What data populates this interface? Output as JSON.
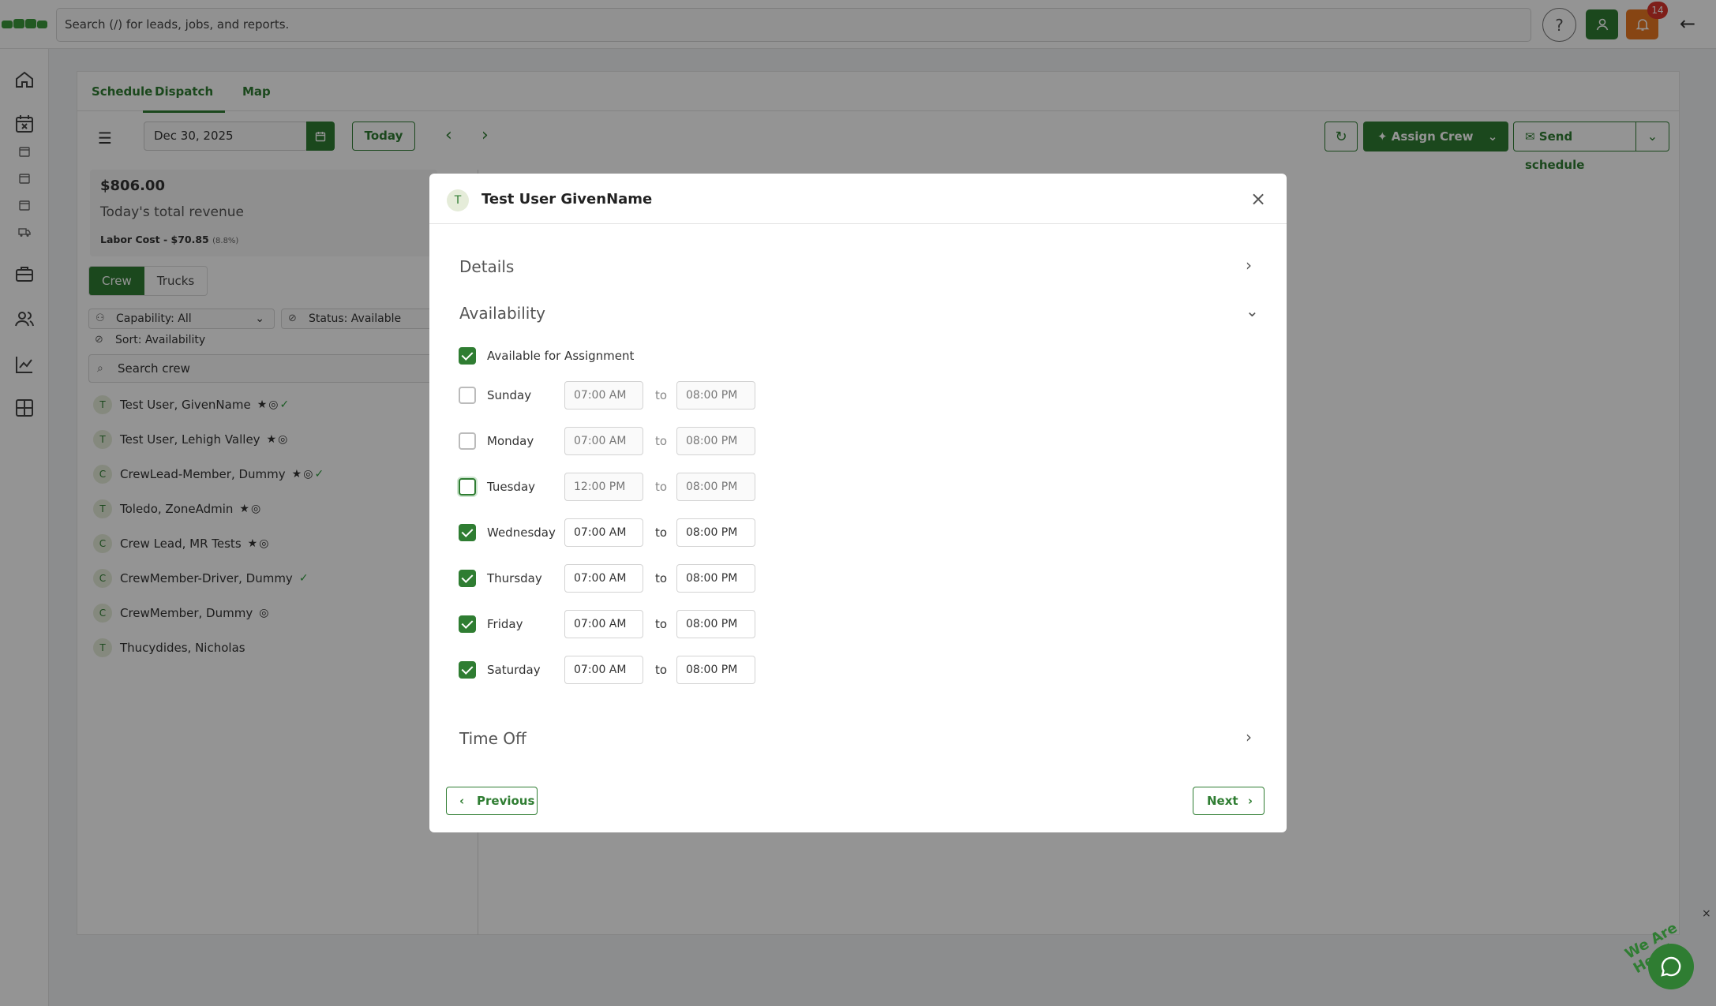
{
  "topbar": {
    "search_placeholder": "Search (/) for leads, jobs, and reports.",
    "help": "?",
    "notification_count": "14",
    "back": "←"
  },
  "tabs": [
    "Schedule",
    "Dispatch",
    "Map"
  ],
  "toolbar": {
    "date": "Dec 30, 2025",
    "today": "Today",
    "assign_crew": "Assign Crew",
    "send_schedule": "Send schedule"
  },
  "revenue": {
    "amount": "$806.00",
    "label": "Today's total revenue",
    "labor": "Labor Cost - $70.85",
    "labor_pct": "(8.8%)"
  },
  "segments": [
    "Crew",
    "Trucks"
  ],
  "filters": {
    "capability": "Capability: All",
    "status": "Status: Available",
    "sort": "Sort: Availability"
  },
  "crew_search_placeholder": "Search crew",
  "crew": [
    {
      "initial": "T",
      "name": "Test User, GivenName",
      "icons": "★◎",
      "ok": "✓"
    },
    {
      "initial": "T",
      "name": "Test User, Lehigh Valley",
      "icons": "★◎",
      "ok": ""
    },
    {
      "initial": "C",
      "name": "CrewLead-Member, Dummy",
      "icons": "★◎",
      "ok": "✓"
    },
    {
      "initial": "T",
      "name": "Toledo, ZoneAdmin",
      "icons": "★◎",
      "ok": ""
    },
    {
      "initial": "C",
      "name": "Crew Lead, MR Tests",
      "icons": "★◎",
      "ok": ""
    },
    {
      "initial": "C",
      "name": "CrewMember-Driver, Dummy",
      "icons": "",
      "ok": "✓"
    },
    {
      "initial": "C",
      "name": "CrewMember, Dummy",
      "icons": "◎",
      "ok": ""
    },
    {
      "initial": "T",
      "name": "Thucydides, Nicholas",
      "icons": "",
      "ok": ""
    }
  ],
  "modal": {
    "avatar_initial": "T",
    "title": "Test User GivenName",
    "details": "Details",
    "availability": "Availability",
    "available_for_assignment": "Available for Assignment",
    "to": "to",
    "days": [
      {
        "name": "Sunday",
        "checked": false,
        "start": "07:00 AM",
        "end": "08:00 PM"
      },
      {
        "name": "Monday",
        "checked": false,
        "start": "07:00 AM",
        "end": "08:00 PM"
      },
      {
        "name": "Tuesday",
        "checked": false,
        "start": "12:00 PM",
        "end": "08:00 PM"
      },
      {
        "name": "Wednesday",
        "checked": true,
        "start": "07:00 AM",
        "end": "08:00 PM"
      },
      {
        "name": "Thursday",
        "checked": true,
        "start": "07:00 AM",
        "end": "08:00 PM"
      },
      {
        "name": "Friday",
        "checked": true,
        "start": "07:00 AM",
        "end": "08:00 PM"
      },
      {
        "name": "Saturday",
        "checked": true,
        "start": "07:00 AM",
        "end": "08:00 PM"
      }
    ],
    "time_off": "Time Off",
    "previous": "Previous",
    "next": "Next"
  },
  "chat": {
    "label": "We Are Here!",
    "close": "×"
  },
  "colors": {
    "brand": "#2f7d32",
    "notification": "#e87722",
    "badge": "#d9352b"
  }
}
